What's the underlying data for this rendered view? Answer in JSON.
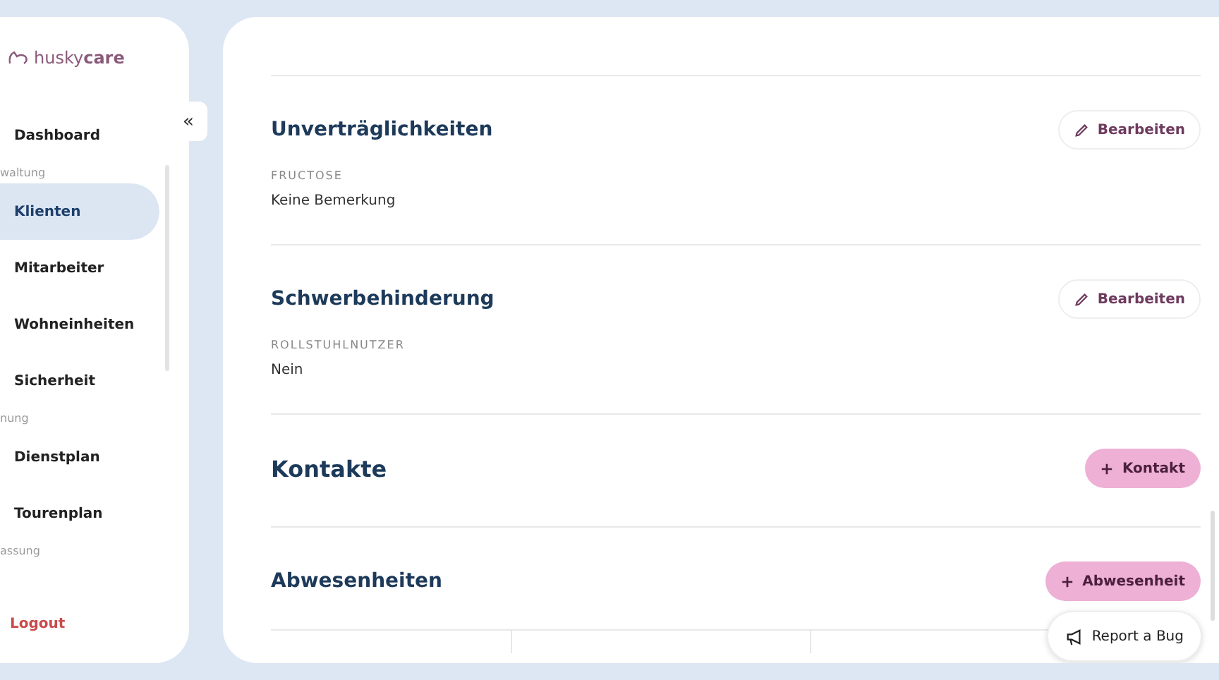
{
  "sidebar": {
    "logo": {
      "brand_part1": "husky",
      "brand_part2": "care"
    },
    "items": [
      {
        "kind": "link",
        "label": "Dashboard",
        "selected": false
      },
      {
        "kind": "section",
        "label": "waltung"
      },
      {
        "kind": "link",
        "label": "Klienten",
        "selected": true
      },
      {
        "kind": "link",
        "label": "Mitarbeiter",
        "selected": false
      },
      {
        "kind": "link",
        "label": "Wohneinheiten",
        "selected": false
      },
      {
        "kind": "link",
        "label": "Sicherheit",
        "selected": false
      },
      {
        "kind": "section",
        "label": "nung"
      },
      {
        "kind": "link",
        "label": "Dienstplan",
        "selected": false
      },
      {
        "kind": "link",
        "label": "Tourenplan",
        "selected": false
      },
      {
        "kind": "section",
        "label": "assung"
      }
    ],
    "logout": "Logout",
    "collapse": "«"
  },
  "sections": [
    {
      "title": "Unverträglichkeiten",
      "action": {
        "kind": "edit",
        "label": "Bearbeiten"
      },
      "fields": [
        {
          "label": "FRUCTOSE",
          "value": "Keine Bemerkung"
        }
      ]
    },
    {
      "title": "Schwerbehinderung",
      "action": {
        "kind": "edit",
        "label": "Bearbeiten"
      },
      "fields": [
        {
          "label": "ROLLSTUHLNUTZER",
          "value": "Nein"
        }
      ]
    },
    {
      "title": "Kontakte",
      "action": {
        "kind": "add",
        "label": "Kontakt"
      }
    },
    {
      "title": "Abwesenheiten",
      "action": {
        "kind": "add",
        "label": "Abwesenheit"
      },
      "has_table": true
    }
  ],
  "report_button": "Report a Bug"
}
